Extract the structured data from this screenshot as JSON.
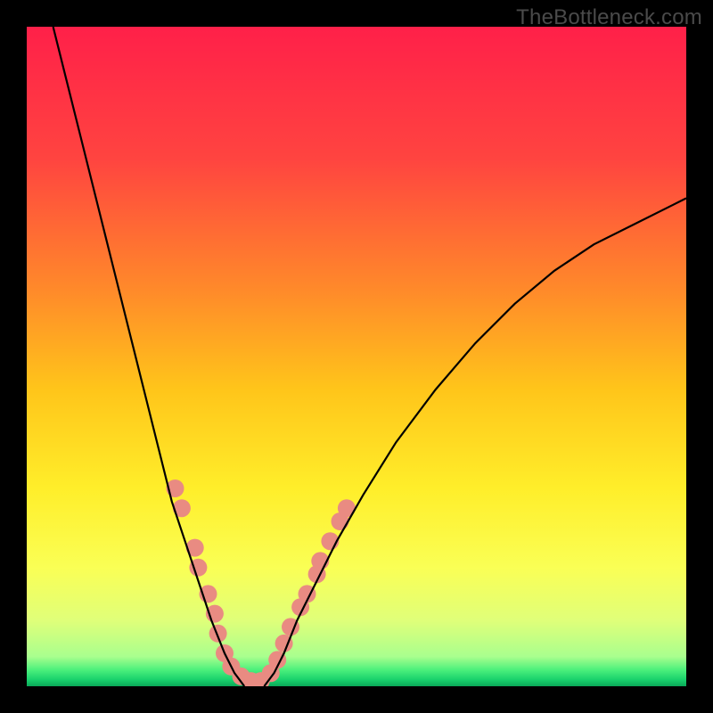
{
  "watermark_text": "TheBottleneck.com",
  "chart_data": {
    "type": "line",
    "title": "",
    "xlabel": "",
    "ylabel": "",
    "xlim": [
      0,
      100
    ],
    "ylim": [
      0,
      100
    ],
    "background": {
      "type": "vertical-gradient",
      "stops": [
        {
          "pos": 0.0,
          "color": "#ff2049"
        },
        {
          "pos": 0.2,
          "color": "#ff4440"
        },
        {
          "pos": 0.4,
          "color": "#ff8a2a"
        },
        {
          "pos": 0.55,
          "color": "#ffc51a"
        },
        {
          "pos": 0.7,
          "color": "#ffee2a"
        },
        {
          "pos": 0.82,
          "color": "#faff55"
        },
        {
          "pos": 0.9,
          "color": "#e0ff79"
        },
        {
          "pos": 0.955,
          "color": "#a9ff8e"
        },
        {
          "pos": 0.975,
          "color": "#4cf07c"
        },
        {
          "pos": 0.99,
          "color": "#19d16c"
        },
        {
          "pos": 1.0,
          "color": "#0aa958"
        }
      ]
    },
    "series": [
      {
        "name": "left-branch",
        "points": [
          {
            "x": 4,
            "y": 100
          },
          {
            "x": 6,
            "y": 92
          },
          {
            "x": 8,
            "y": 84
          },
          {
            "x": 10,
            "y": 76
          },
          {
            "x": 12,
            "y": 68
          },
          {
            "x": 14,
            "y": 60
          },
          {
            "x": 16,
            "y": 52
          },
          {
            "x": 18,
            "y": 44
          },
          {
            "x": 20,
            "y": 36
          },
          {
            "x": 22,
            "y": 28
          },
          {
            "x": 24,
            "y": 22
          },
          {
            "x": 26,
            "y": 16
          },
          {
            "x": 28,
            "y": 10
          },
          {
            "x": 30,
            "y": 5
          },
          {
            "x": 31.5,
            "y": 2
          },
          {
            "x": 33,
            "y": 0
          }
        ]
      },
      {
        "name": "right-branch",
        "points": [
          {
            "x": 36,
            "y": 0
          },
          {
            "x": 37.5,
            "y": 2
          },
          {
            "x": 39,
            "y": 5
          },
          {
            "x": 41,
            "y": 10
          },
          {
            "x": 44,
            "y": 16
          },
          {
            "x": 47,
            "y": 22
          },
          {
            "x": 51,
            "y": 29
          },
          {
            "x": 56,
            "y": 37
          },
          {
            "x": 62,
            "y": 45
          },
          {
            "x": 68,
            "y": 52
          },
          {
            "x": 74,
            "y": 58
          },
          {
            "x": 80,
            "y": 63
          },
          {
            "x": 86,
            "y": 67
          },
          {
            "x": 92,
            "y": 70
          },
          {
            "x": 98,
            "y": 73
          },
          {
            "x": 100,
            "y": 74
          }
        ]
      }
    ],
    "markers": {
      "color": "#e98b82",
      "radius": 10,
      "points": [
        {
          "x": 22.5,
          "y": 30
        },
        {
          "x": 23.5,
          "y": 27
        },
        {
          "x": 25.5,
          "y": 21
        },
        {
          "x": 26,
          "y": 18
        },
        {
          "x": 27.5,
          "y": 14
        },
        {
          "x": 28.5,
          "y": 11
        },
        {
          "x": 29,
          "y": 8
        },
        {
          "x": 30,
          "y": 5
        },
        {
          "x": 31,
          "y": 3
        },
        {
          "x": 32.5,
          "y": 1.5
        },
        {
          "x": 34,
          "y": 0.8
        },
        {
          "x": 35.5,
          "y": 0.8
        },
        {
          "x": 37,
          "y": 2
        },
        {
          "x": 38,
          "y": 4
        },
        {
          "x": 39,
          "y": 6.5
        },
        {
          "x": 40,
          "y": 9
        },
        {
          "x": 41.5,
          "y": 12
        },
        {
          "x": 42.5,
          "y": 14
        },
        {
          "x": 44,
          "y": 17
        },
        {
          "x": 44.5,
          "y": 19
        },
        {
          "x": 46,
          "y": 22
        },
        {
          "x": 47.5,
          "y": 25
        },
        {
          "x": 48.5,
          "y": 27
        }
      ]
    }
  }
}
